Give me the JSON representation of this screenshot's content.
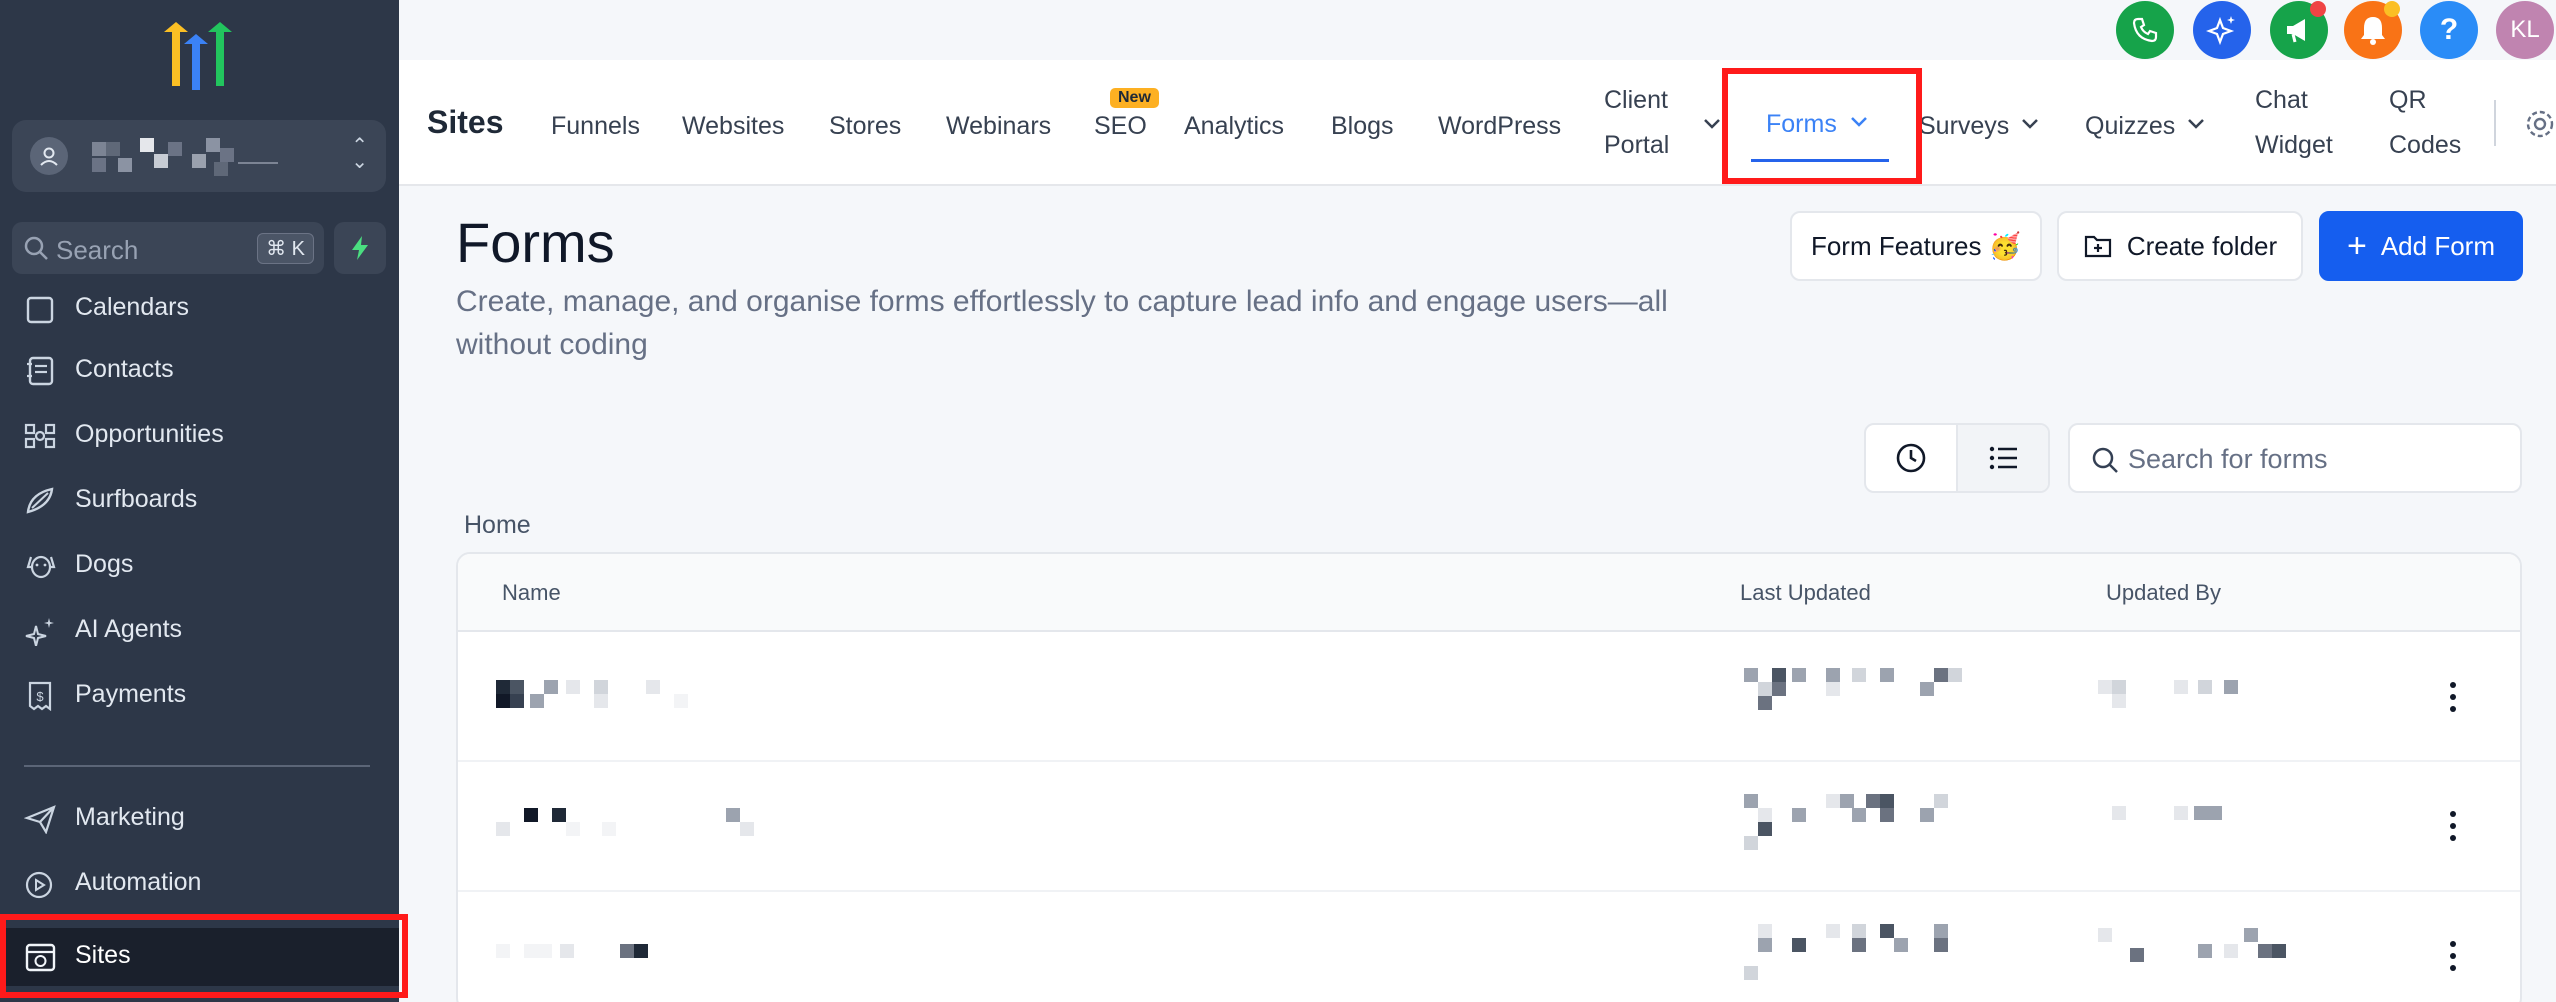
{
  "sidebar": {
    "search_placeholder": "Search",
    "search_shortcut": "⌘ K",
    "items": [
      {
        "label": "Calendars",
        "icon": "calendar-icon"
      },
      {
        "label": "Contacts",
        "icon": "contacts-icon"
      },
      {
        "label": "Opportunities",
        "icon": "opportunities-icon"
      },
      {
        "label": "Surfboards",
        "icon": "surfboard-icon"
      },
      {
        "label": "Dogs",
        "icon": "dog-icon"
      },
      {
        "label": "AI Agents",
        "icon": "sparkle-icon"
      },
      {
        "label": "Payments",
        "icon": "payments-icon"
      },
      {
        "label": "Marketing",
        "icon": "send-icon"
      },
      {
        "label": "Automation",
        "icon": "automation-icon"
      },
      {
        "label": "Sites",
        "icon": "sites-icon"
      }
    ],
    "active_item": "Sites"
  },
  "top_icons": {
    "avatar_initials": "KL",
    "help_label": "?",
    "colors": {
      "phone": "#16a34a",
      "ai": "#2563eb",
      "marketing": "#16a34a",
      "notifications": "#f97316",
      "help": "#2a8cf7",
      "avatar": "#c084b0"
    }
  },
  "topnav": {
    "title": "Sites",
    "tabs": [
      {
        "label": "Funnels"
      },
      {
        "label": "Websites"
      },
      {
        "label": "Stores"
      },
      {
        "label": "Webinars"
      },
      {
        "label": "SEO",
        "badge": "New"
      },
      {
        "label": "Analytics"
      },
      {
        "label": "Blogs"
      },
      {
        "label": "WordPress"
      },
      {
        "label_line1": "Client",
        "label_line2": "Portal",
        "dropdown": true
      },
      {
        "label": "Forms",
        "dropdown": true,
        "active": true
      },
      {
        "label": "Surveys",
        "dropdown": true
      },
      {
        "label": "Quizzes",
        "dropdown": true
      },
      {
        "label_line1": "Chat",
        "label_line2": "Widget"
      },
      {
        "label_line1": "QR",
        "label_line2": "Codes"
      }
    ]
  },
  "main": {
    "title": "Forms",
    "description": "Create, manage, and organise forms effortlessly to capture lead info and engage users—all without coding",
    "buttons": {
      "features": "Form Features 🥳",
      "create_folder": "Create folder",
      "add_form": "Add Form"
    },
    "search_placeholder": "Search for forms",
    "breadcrumb": "Home",
    "table": {
      "columns": [
        "Name",
        "Last Updated",
        "Updated By"
      ],
      "row_count_visible": 3
    }
  }
}
